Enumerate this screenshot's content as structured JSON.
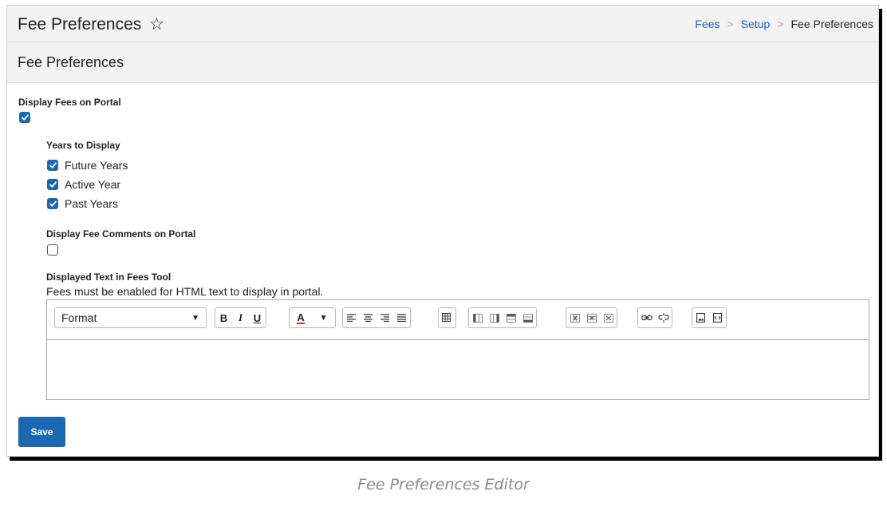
{
  "header": {
    "title": "Fee Preferences",
    "breadcrumb": [
      "Fees",
      "Setup",
      "Fee Preferences"
    ]
  },
  "section": {
    "title": "Fee Preferences"
  },
  "form": {
    "display_fees_label": "Display Fees on Portal",
    "display_fees_checked": true,
    "years_label": "Years to Display",
    "years": [
      {
        "label": "Future Years",
        "checked": true
      },
      {
        "label": "Active Year",
        "checked": true
      },
      {
        "label": "Past Years",
        "checked": true
      }
    ],
    "comments_label": "Display Fee Comments on Portal",
    "comments_checked": false,
    "displayed_text_label": "Displayed Text in Fees Tool",
    "displayed_text_note": "Fees must be enabled for HTML text to display in portal.",
    "editor_value": ""
  },
  "toolbar": {
    "format_label": "Format",
    "bold": "B",
    "italic": "I",
    "underline": "U",
    "font_color": "A"
  },
  "actions": {
    "save_label": "Save"
  },
  "caption": "Fee Preferences Editor",
  "colors": {
    "accent": "#1a67b3",
    "header_bg": "#f3f3f3",
    "caption": "#8a8a8a"
  }
}
